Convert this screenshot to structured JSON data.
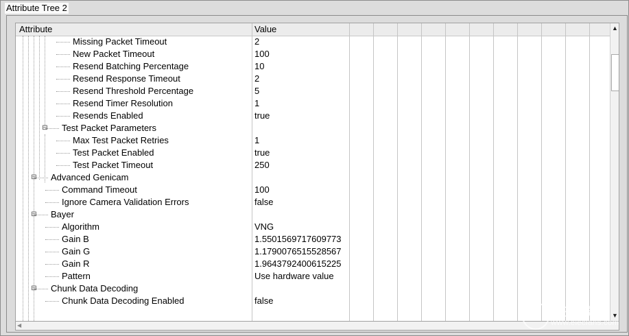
{
  "window": {
    "title": "Attribute Tree 2"
  },
  "header": {
    "attribute": "Attribute",
    "value": "Value"
  },
  "rows": [
    {
      "label": "Missing Packet Timeout",
      "value": "2",
      "level": 3,
      "toggle": ""
    },
    {
      "label": "New Packet Timeout",
      "value": "100",
      "level": 3,
      "toggle": ""
    },
    {
      "label": "Resend Batching Percentage",
      "value": "10",
      "level": 3,
      "toggle": ""
    },
    {
      "label": "Resend Response Timeout",
      "value": "2",
      "level": 3,
      "toggle": ""
    },
    {
      "label": "Resend Threshold Percentage",
      "value": "5",
      "level": 3,
      "toggle": ""
    },
    {
      "label": "Resend Timer Resolution",
      "value": "1",
      "level": 3,
      "toggle": ""
    },
    {
      "label": "Resends Enabled",
      "value": "true",
      "level": 3,
      "toggle": ""
    },
    {
      "label": "Test Packet Parameters",
      "value": "",
      "level": 2,
      "toggle": "⊟"
    },
    {
      "label": "Max Test Packet Retries",
      "value": "1",
      "level": 3,
      "toggle": ""
    },
    {
      "label": "Test Packet Enabled",
      "value": "true",
      "level": 3,
      "toggle": ""
    },
    {
      "label": "Test Packet Timeout",
      "value": "250",
      "level": 3,
      "toggle": ""
    },
    {
      "label": "Advanced Genicam",
      "value": "",
      "level": 1,
      "toggle": "⊟"
    },
    {
      "label": "Command Timeout",
      "value": "100",
      "level": 2,
      "toggle": ""
    },
    {
      "label": "Ignore Camera Validation Errors",
      "value": "false",
      "level": 2,
      "toggle": ""
    },
    {
      "label": "Bayer",
      "value": "",
      "level": 1,
      "toggle": "⊟"
    },
    {
      "label": "Algorithm",
      "value": "VNG",
      "level": 2,
      "toggle": ""
    },
    {
      "label": "Gain B",
      "value": "1.5501569717609773",
      "level": 2,
      "toggle": ""
    },
    {
      "label": "Gain G",
      "value": "1.1790076515528567",
      "level": 2,
      "toggle": ""
    },
    {
      "label": "Gain R",
      "value": "1.9643792400615225",
      "level": 2,
      "toggle": ""
    },
    {
      "label": "Pattern",
      "value": "Use hardware value",
      "level": 2,
      "toggle": ""
    },
    {
      "label": "Chunk Data Decoding",
      "value": "",
      "level": 1,
      "toggle": "⊟"
    },
    {
      "label": "Chunk Data Decoding Enabled",
      "value": "false",
      "level": 2,
      "toggle": ""
    }
  ],
  "scrollbar": {
    "up_icon": "▲",
    "down_icon": "▼"
  },
  "watermark": {
    "line1": "电子发烧友",
    "line2": "www.elecfans.com"
  },
  "colors": {
    "panel_bg": "#ffffff",
    "window_bg": "#dcdcdc",
    "grid_line": "#c4c4c4"
  }
}
